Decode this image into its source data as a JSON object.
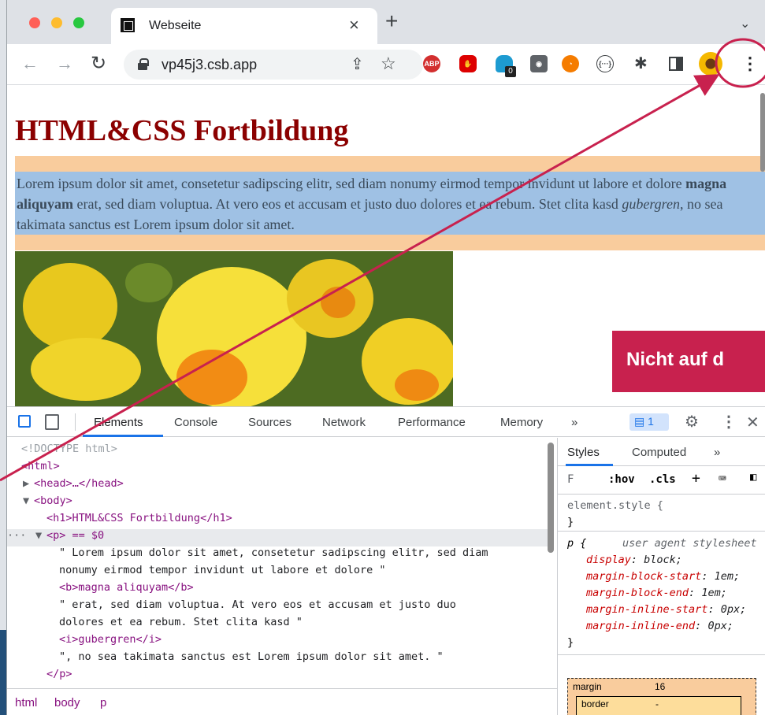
{
  "browser": {
    "tab_title": "Webseite",
    "tab_close": "×",
    "new_tab": "+",
    "tab_menu": "⌄",
    "url": "vp45j3.csb.app",
    "extensions": [
      {
        "name": "adblock-plus-icon",
        "label": "ABP"
      },
      {
        "name": "ublock-icon",
        "label": ""
      },
      {
        "name": "ghostery-icon",
        "label": ""
      },
      {
        "name": "camera-icon",
        "label": ""
      },
      {
        "name": "orange-extension-icon",
        "label": ""
      },
      {
        "name": "braces-extension-icon",
        "label": "{···}"
      }
    ],
    "ext_badge": "0"
  },
  "page": {
    "title": "HTML&CSS Fortbildung",
    "para_pre": "Lorem ipsum dolor sit amet, consetetur sadipscing elitr, sed diam nonumy eirmod tempor invidunt ut labore et dolore ",
    "para_bold": "magna aliquyam",
    "para_mid": " erat, sed diam voluptua. At vero eos et accusam et justo duo dolores et ea rebum. Stet clita kasd ",
    "para_italic": "gubergren",
    "para_post": ", no sea takimata sanctus est Lorem ipsum dolor sit amet.",
    "callout": "Nicht auf d"
  },
  "devtools": {
    "tabs": [
      "Elements",
      "Console",
      "Sources",
      "Network",
      "Performance",
      "Memory",
      "»"
    ],
    "issues_count": "1",
    "dom_lines": [
      "<!DOCTYPE html>",
      "<html>",
      "<head>…</head>",
      "<body>",
      "<h1>HTML&CSS Fortbildung</h1>",
      "<p> == $0",
      "\" Lorem ipsum dolor sit amet, consetetur sadipscing elitr, sed diam",
      "nonumy eirmod tempor invidunt ut labore et dolore \"",
      "<b>magna aliquyam</b>",
      "\" erat, sed diam voluptua. At vero eos et accusam et justo duo",
      "dolores et ea rebum. Stet clita kasd \"",
      "<i>gubergren</i>",
      "\", no sea takimata sanctus est Lorem ipsum dolor sit amet. \"",
      "</p>"
    ],
    "breadcrumbs": [
      "html",
      "body",
      "p"
    ],
    "styles_tabs": [
      "Styles",
      "Computed",
      "»"
    ],
    "filter_placeholder": "F",
    "hov": ":hov",
    "cls": ".cls",
    "element_style": "element.style {",
    "close_brace": "}",
    "rule_selector": "p {",
    "rule_source": "user agent stylesheet",
    "rule_props": [
      {
        "prop": "display",
        "val": "block;"
      },
      {
        "prop": "margin-block-start",
        "val": "1em;"
      },
      {
        "prop": "margin-block-end",
        "val": "1em;"
      },
      {
        "prop": "margin-inline-start",
        "val": "0px;"
      },
      {
        "prop": "margin-inline-end",
        "val": "0px;"
      }
    ],
    "box_margin_label": "margin",
    "box_margin_value": "16",
    "box_border_label": "border",
    "box_border_value": "-"
  },
  "colors": {
    "annotation": "#c8214e",
    "heading": "#8b0000"
  }
}
